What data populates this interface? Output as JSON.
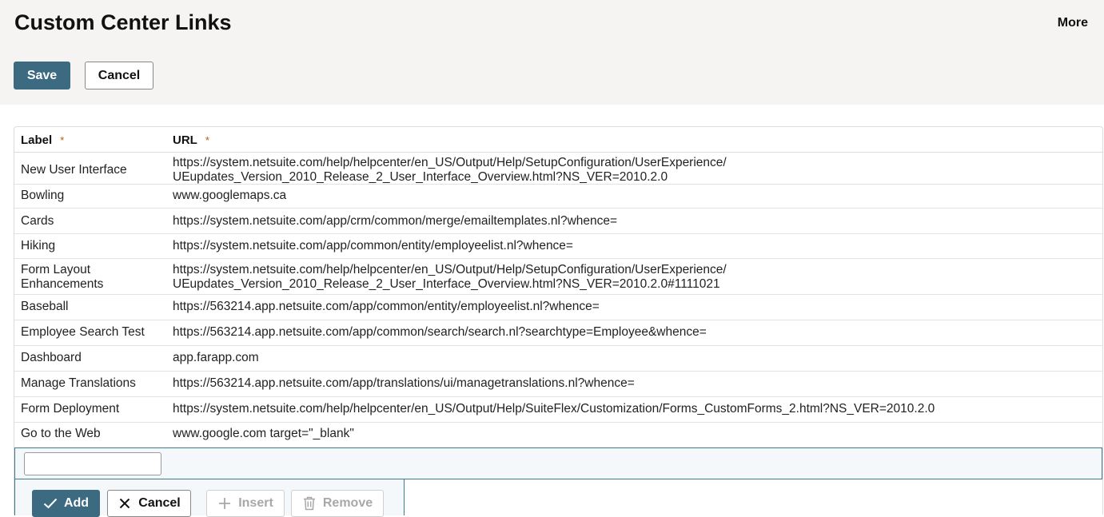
{
  "header": {
    "title": "Custom Center Links",
    "more_label": "More",
    "save_label": "Save",
    "cancel_label": "Cancel"
  },
  "table": {
    "columns": {
      "label": "Label",
      "url": "URL",
      "required_marker": "*"
    },
    "rows": [
      {
        "label": "New User Interface",
        "url_line1": "https://system.netsuite.com/help/helpcenter/en_US/Output/Help/SetupConfiguration/UserExperience/",
        "url_line2": "UEupdates_Version_2010_Release_2_User_Interface_Overview.html?NS_VER=2010.2.0"
      },
      {
        "label": "Bowling",
        "url": "www.googlemaps.ca"
      },
      {
        "label": "Cards",
        "url": "https://system.netsuite.com/app/crm/common/merge/emailtemplates.nl?whence="
      },
      {
        "label": "Hiking",
        "url": "https://system.netsuite.com/app/common/entity/employeelist.nl?whence="
      },
      {
        "label_line1": "Form Layout",
        "label_line2": "Enhancements",
        "url_line1": "https://system.netsuite.com/help/helpcenter/en_US/Output/Help/SetupConfiguration/UserExperience/",
        "url_line2": "UEupdates_Version_2010_Release_2_User_Interface_Overview.html?NS_VER=2010.2.0#1111021"
      },
      {
        "label": "Baseball",
        "url": "https://563214.app.netsuite.com/app/common/entity/employeelist.nl?whence="
      },
      {
        "label": "Employee Search Test",
        "url": "https://563214.app.netsuite.com/app/common/search/search.nl?searchtype=Employee&whence="
      },
      {
        "label": "Dashboard",
        "url": "app.farapp.com"
      },
      {
        "label": "Manage Translations",
        "url": "https://563214.app.netsuite.com/app/translations/ui/managetranslations.nl?whence="
      },
      {
        "label": "Form Deployment",
        "url": "https://system.netsuite.com/help/helpcenter/en_US/Output/Help/SuiteFlex/Customization/Forms_CustomForms_2.html?NS_VER=2010.2.0"
      },
      {
        "label": "Go to the Web",
        "url": "www.google.com target=\"_blank\""
      }
    ]
  },
  "edit_row": {
    "label_value": ""
  },
  "row_actions": {
    "add_label": "Add",
    "cancel_label": "Cancel",
    "insert_label": "Insert",
    "remove_label": "Remove"
  },
  "colors": {
    "primary": "#3c6a80",
    "header_bg": "#f5f4f2",
    "required": "#c05a00",
    "edit_border": "#3f7a8c"
  }
}
